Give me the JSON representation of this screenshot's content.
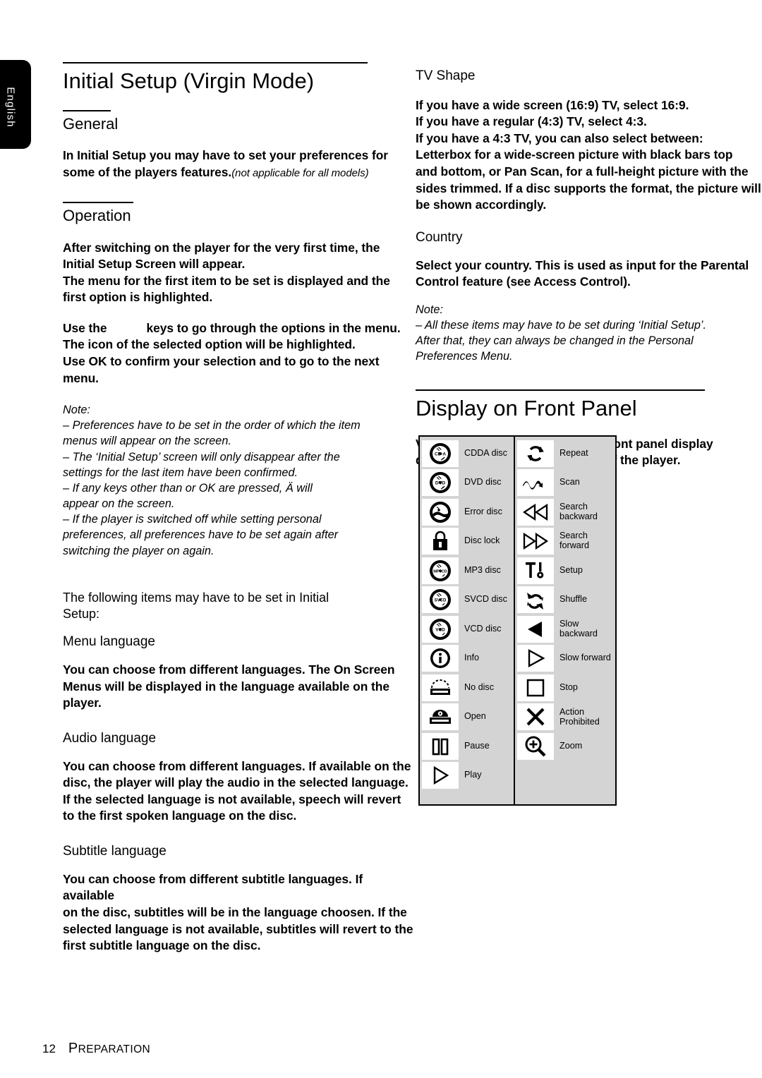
{
  "language_tab": "English",
  "left_column": {
    "chapter_title": "Initial Setup (Virgin Mode)",
    "section_general": "General",
    "general_body_line1": "In Initial Setup you may have to set your preferences for",
    "general_body_line2": "some of the players features.",
    "general_body_italic": "(not applicable for all models)",
    "section_operation": "Operation",
    "operation_p1_line1": "After switching on the player for the very first time, the",
    "operation_p1_line2": "Initial Setup Screen will appear.",
    "operation_p1_line3": "The menu for the first item to be set is displayed and the",
    "operation_p1_line4": "first option is highlighted.",
    "operation_p2_line1_a": "Use the",
    "operation_p2_line1_b": "keys to go through the options in the menu.",
    "operation_p2_line2": "The icon of the selected option will be highlighted.",
    "operation_p2_line3": "Use OK to confirm your selection and to go to the next",
    "operation_p2_line4": "menu.",
    "note_label": "Note:",
    "note_items": [
      "–  Preferences have to be set in the order of which the item",
      "menus will appear on the screen.",
      "–  The ‘Initial Setup’ screen will only disappear after the",
      "settings for the last item have been confirmed.",
      "–  If any keys other than            or OK are pressed, Ä  will",
      "appear on the screen.",
      "–  If the player is switched off while setting personal",
      "preferences, all preferences have to be set again after",
      "switching the player on again."
    ],
    "following_items_line1": "The following items may have to be set in Initial",
    "following_items_line2": "Setup:",
    "sub_menu_language": "Menu language",
    "menu_language_body": [
      "You can choose from different languages. The On Screen",
      "Menus will be displayed in the language available on the",
      "player."
    ],
    "sub_audio_language": "Audio language",
    "audio_language_body": [
      "You can choose from different languages. If available on the",
      "disc, the player will play the audio in the selected language.",
      "If the selected language is not available, speech will revert",
      "to the first spoken language on the disc."
    ],
    "sub_subtitle_language": "Subtitle language",
    "subtitle_language_body": [
      "You can choose from different subtitle languages. If available",
      "on the disc, subtitles will be in the language choosen. If the",
      "selected language is not available, subtitles will revert to the",
      "first subtitle language on the disc."
    ]
  },
  "right_column": {
    "sub_tv_shape": "TV Shape",
    "tv_shape_body": [
      "If you have a wide screen (16:9) TV, select 16:9.",
      "If you have a regular (4:3) TV, select 4:3.",
      "If you have a 4:3 TV, you can also select between:",
      "Letterbox for a wide-screen picture with black bars top",
      "and bottom, or Pan Scan, for a full-height picture with the",
      "sides trimmed. If a disc supports the format, the picture will",
      "be shown accordingly."
    ],
    "sub_country": "Country",
    "country_body": [
      "Select your country. This is used as input for the Parental",
      "Control feature (see Access Control)."
    ],
    "note_label": "Note:",
    "note_items": [
      "–  All these items may have to be set during ‘Initial Setup’.",
      "After that, they can always be changed in the Personal",
      "Preferences Menu."
    ],
    "chapter_title": "Display on Front Panel",
    "intro_body": [
      "Various icons will appear on the front panel display",
      "depending on the current status of the player."
    ]
  },
  "icon_table": {
    "left_items": [
      {
        "icon": "cdda-disc-icon",
        "label": "CDDA disc",
        "disc_text": "CD-A"
      },
      {
        "icon": "dvd-disc-icon",
        "label": "DVD disc",
        "disc_text": "DVD"
      },
      {
        "icon": "error-disc-icon",
        "label": "Error disc",
        "disc_text": ""
      },
      {
        "icon": "disc-lock-icon",
        "label": "Disc lock",
        "disc_text": ""
      },
      {
        "icon": "mp3-disc-icon",
        "label": "MP3 disc",
        "disc_text": "MP3CD"
      },
      {
        "icon": "svcd-disc-icon",
        "label": "SVCD disc",
        "disc_text": "SVCD"
      },
      {
        "icon": "vcd-disc-icon",
        "label": "VCD disc",
        "disc_text": "VCD"
      },
      {
        "icon": "info-icon",
        "label": "Info",
        "disc_text": ""
      },
      {
        "icon": "no-disc-icon",
        "label": "No disc",
        "disc_text": ""
      },
      {
        "icon": "open-tray-icon",
        "label": "Open",
        "disc_text": ""
      },
      {
        "icon": "pause-icon",
        "label": "Pause",
        "disc_text": ""
      },
      {
        "icon": "play-icon",
        "label": "Play",
        "disc_text": ""
      }
    ],
    "right_items": [
      {
        "icon": "repeat-icon",
        "label": "Repeat"
      },
      {
        "icon": "scan-icon",
        "label": "Scan"
      },
      {
        "icon": "search-backward-icon",
        "label": "Search backward"
      },
      {
        "icon": "search-forward-icon",
        "label": "Search forward"
      },
      {
        "icon": "setup-icon",
        "label": "Setup"
      },
      {
        "icon": "shuffle-icon",
        "label": "Shuffle"
      },
      {
        "icon": "slow-backward-icon",
        "label": "Slow backward"
      },
      {
        "icon": "slow-forward-icon",
        "label": "Slow forward"
      },
      {
        "icon": "stop-icon",
        "label": "Stop"
      },
      {
        "icon": "action-prohibited-icon",
        "label": "Action\nProhibited"
      },
      {
        "icon": "zoom-icon",
        "label": "Zoom"
      }
    ]
  },
  "footer": {
    "page_number": "12",
    "section_first": "P",
    "section_rest": "REPARATION"
  },
  "colors": {
    "table_background": "#d4d4d4",
    "cell_background": "#ffffff",
    "ink": "#000000",
    "tab_background": "#000000"
  }
}
